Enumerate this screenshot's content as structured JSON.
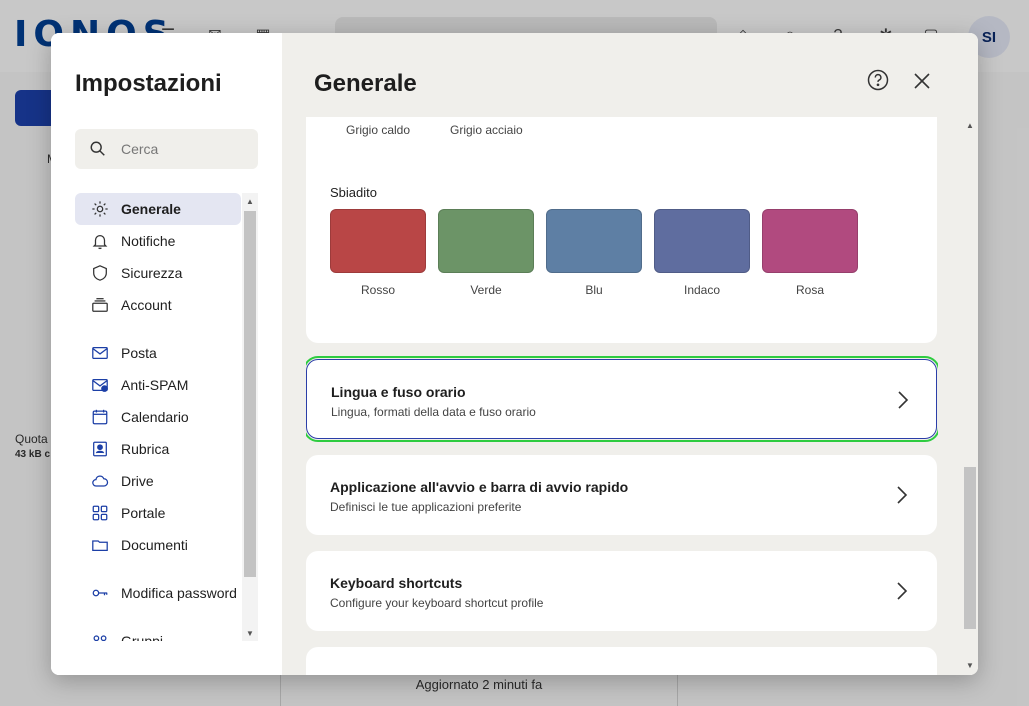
{
  "background": {
    "logo": "IONOS",
    "avatar": "SI",
    "side_quota": "Quota",
    "side_quota_value": "43 kB c",
    "side_letter": "M",
    "status": "Aggiornato 2 minuti fa"
  },
  "sidebar": {
    "title": "Impostazioni",
    "search_placeholder": "Cerca",
    "items": [
      {
        "label": "Generale",
        "icon": "gear-icon"
      },
      {
        "label": "Notifiche",
        "icon": "bell-icon"
      },
      {
        "label": "Sicurezza",
        "icon": "shield-icon"
      },
      {
        "label": "Account",
        "icon": "account-icon"
      },
      {
        "label": "Posta",
        "icon": "mail-icon"
      },
      {
        "label": "Anti-SPAM",
        "icon": "antispam-icon"
      },
      {
        "label": "Calendario",
        "icon": "calendar-icon"
      },
      {
        "label": "Rubrica",
        "icon": "contacts-icon"
      },
      {
        "label": "Drive",
        "icon": "cloud-icon"
      },
      {
        "label": "Portale",
        "icon": "grid-icon"
      },
      {
        "label": "Documenti",
        "icon": "folder-icon"
      },
      {
        "label": "Modifica password",
        "icon": "key-icon"
      },
      {
        "label": "Gruppi",
        "icon": "groups-icon"
      }
    ]
  },
  "main": {
    "title": "Generale",
    "theme": {
      "top_swatches": [
        "Grigio caldo",
        "Grigio acciaio"
      ],
      "faded_title": "Sbiadito",
      "faded_swatches": [
        {
          "name": "Rosso",
          "color": "#b94646"
        },
        {
          "name": "Verde",
          "color": "#6c9467"
        },
        {
          "name": "Blu",
          "color": "#5e7fa4"
        },
        {
          "name": "Indaco",
          "color": "#5f6d9f"
        },
        {
          "name": "Rosa",
          "color": "#b14a7f"
        }
      ]
    },
    "cards": [
      {
        "title": "Lingua e fuso orario",
        "subtitle": "Lingua, formati della data e fuso orario"
      },
      {
        "title": "Applicazione all'avvio e barra di avvio rapido",
        "subtitle": "Definisci le tue applicazioni preferite"
      },
      {
        "title": "Keyboard shortcuts",
        "subtitle": "Configure your keyboard shortcut profile"
      }
    ]
  },
  "colors": {
    "accent": "#2b3ea8",
    "highlight": "#2ecc40",
    "active_nav": "#e4e6f2"
  }
}
